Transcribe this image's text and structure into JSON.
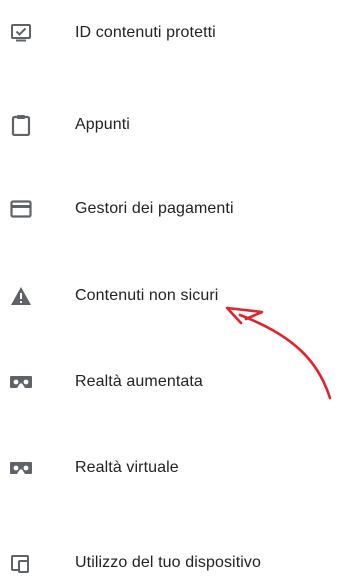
{
  "settings_list": {
    "items": [
      {
        "label": "ID contenuti protetti",
        "icon": "protected-content-icon"
      },
      {
        "label": "Appunti",
        "icon": "clipboard-icon"
      },
      {
        "label": "Gestori dei pagamenti",
        "icon": "credit-card-icon"
      },
      {
        "label": "Contenuti non sicuri",
        "icon": "warning-icon"
      },
      {
        "label": "Realtà aumentata",
        "icon": "vr-headset-icon"
      },
      {
        "label": "Realtà virtuale",
        "icon": "vr-headset-icon"
      },
      {
        "label": "Utilizzo del tuo dispositivo",
        "icon": "device-usage-icon"
      }
    ]
  },
  "colors": {
    "icon": "#5f6368",
    "text": "#222222",
    "annotation_arrow": "#e0242b"
  }
}
